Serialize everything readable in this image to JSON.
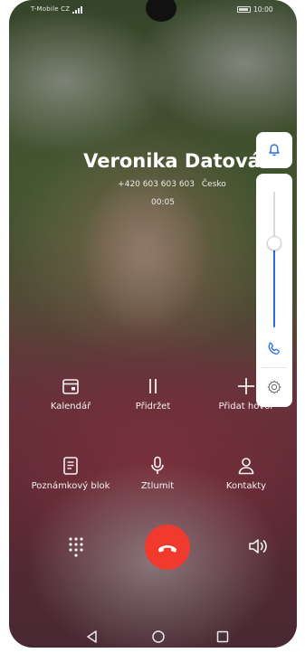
{
  "status_bar": {
    "carrier": "T-Mobile CZ",
    "time": "10:00"
  },
  "caller": {
    "name": "Veronika Datová",
    "number": "+420 603 603 603",
    "country": "Česko",
    "duration": "00:05"
  },
  "volume_panel": {
    "ring_mode_icon": "bell-icon",
    "call_volume_level": 0.62,
    "slider_icon": "phone-icon",
    "settings_icon": "gear-icon"
  },
  "actions": {
    "calendar": "Kalendář",
    "hold": "Přidržet",
    "add_call": "Přidat hovor",
    "notepad": "Poznámkový blok",
    "mute": "Ztlumit",
    "contacts": "Kontakty"
  },
  "bottom_controls": {
    "dialpad_icon": "dialpad-icon",
    "end_call_icon": "hangup-icon",
    "speaker_icon": "speaker-icon",
    "end_call_color": "#f03a2e"
  },
  "navigation": {
    "back_icon": "back-icon",
    "home_icon": "home-icon",
    "recents_icon": "recents-icon"
  },
  "colors": {
    "accent": "#2d6ce0",
    "text": "#ffffff"
  }
}
